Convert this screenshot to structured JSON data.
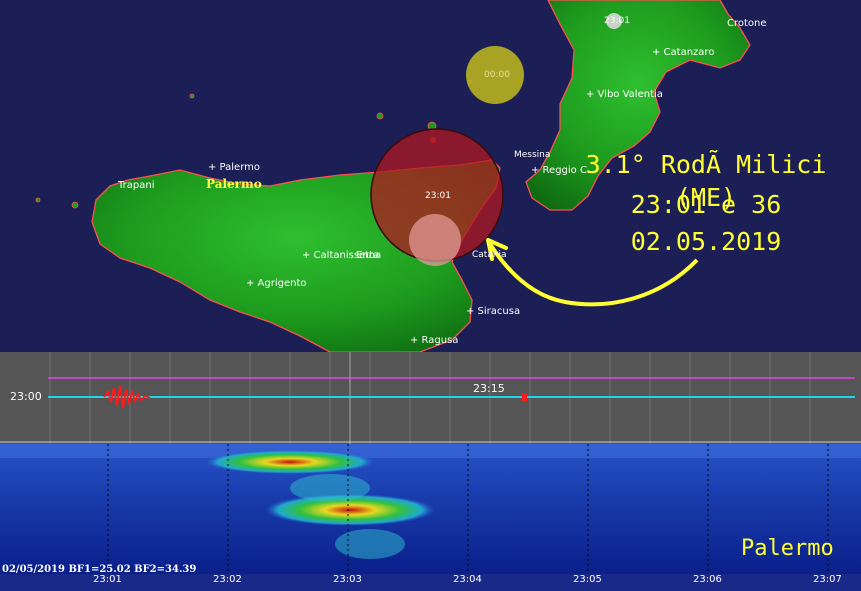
{
  "map": {
    "cities": [
      {
        "name": "Crotone"
      },
      {
        "name": "+ Catanzaro"
      },
      {
        "name": "+ Vibo Valentia"
      },
      {
        "name": "+ Reggio C."
      },
      {
        "name": "Messina"
      },
      {
        "name": "+ Palermo"
      },
      {
        "name": "Trapani"
      },
      {
        "name": "+ Caltanissetta"
      },
      {
        "name": "Enna"
      },
      {
        "name": "+ Agrigento"
      },
      {
        "name": "+ Siracusa"
      },
      {
        "name": "+ Ragusa"
      },
      {
        "name": "Catania"
      }
    ],
    "station_label": "Palermo",
    "circle_time": "23:01",
    "top_circle_time": "00:00",
    "event_circle_time": "23:01"
  },
  "quake": {
    "line1": "3.1° RodÃ  Milici (ME)",
    "line2": "23:01 e 36",
    "line3": "02.05.2019"
  },
  "seismogram": {
    "row_label": "23:00",
    "mid_label": "23:15",
    "trace_color": "#22d3ee",
    "magenta_color": "#ff44ff"
  },
  "spectrogram": {
    "footer": "02/05/2019 BF1=25.02 BF2=34.39",
    "station": "Palermo",
    "ticks": [
      "23:01",
      "23:02",
      "23:03",
      "23:04",
      "23:05",
      "23:06",
      "23:07"
    ]
  },
  "colors": {
    "sea": "#1b1f55",
    "land": "#1f9a1f",
    "event_circle": "#b01820",
    "yellow_circle": "#b8b020",
    "annotation": "#ffff33"
  }
}
